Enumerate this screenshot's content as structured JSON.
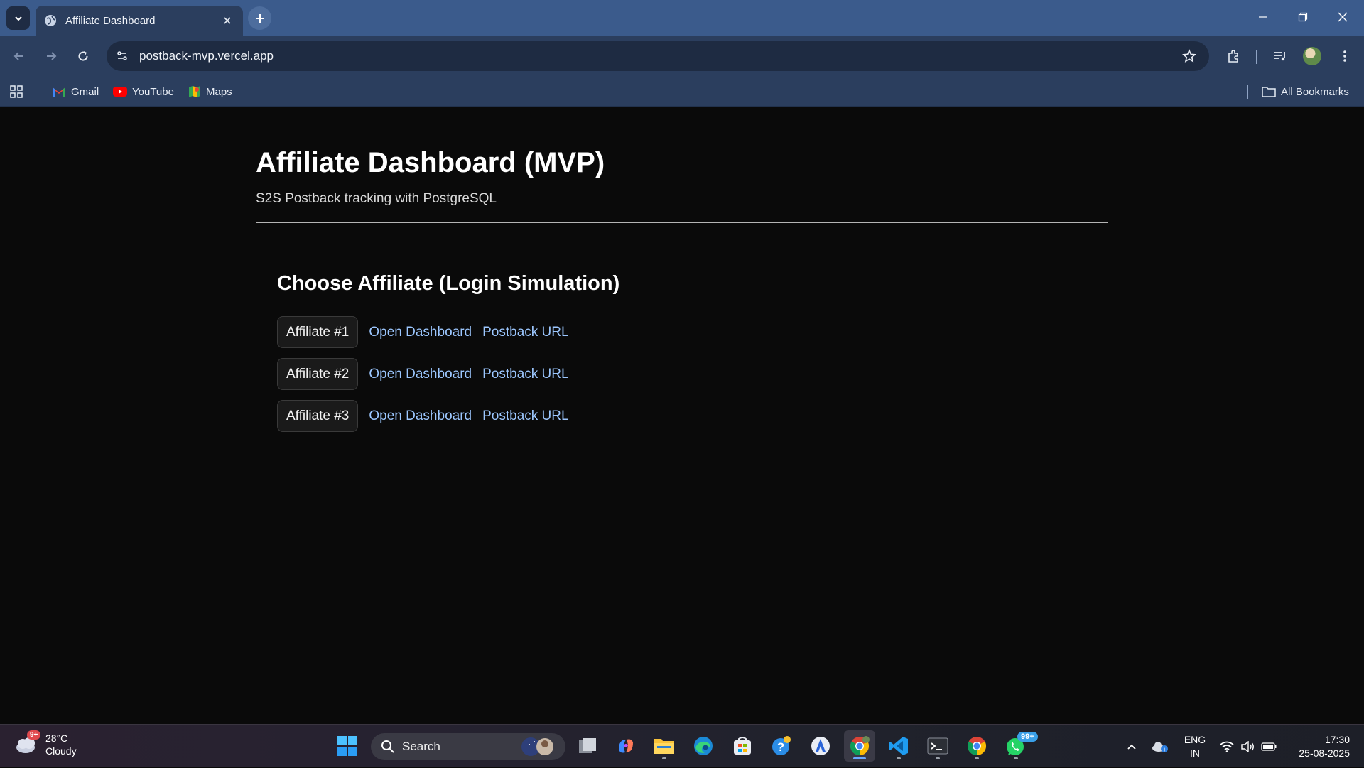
{
  "browser": {
    "tab_title": "Affiliate Dashboard",
    "url": "postback-mvp.vercel.app",
    "bookmarks": [
      {
        "label": "Gmail",
        "icon": "gmail-icon"
      },
      {
        "label": "YouTube",
        "icon": "youtube-icon"
      },
      {
        "label": "Maps",
        "icon": "maps-icon"
      }
    ],
    "all_bookmarks_label": "All Bookmarks"
  },
  "page": {
    "title": "Affiliate Dashboard (MVP)",
    "subtitle": "S2S Postback tracking with PostgreSQL",
    "section_title": "Choose Affiliate (Login Simulation)",
    "affiliates": [
      {
        "label": "Affiliate #1",
        "dashboard_link": "Open Dashboard",
        "postback_link": "Postback URL"
      },
      {
        "label": "Affiliate #2",
        "dashboard_link": "Open Dashboard",
        "postback_link": "Postback URL"
      },
      {
        "label": "Affiliate #3",
        "dashboard_link": "Open Dashboard",
        "postback_link": "Postback URL"
      }
    ]
  },
  "taskbar": {
    "weather": {
      "temp": "28°C",
      "condition": "Cloudy",
      "badge": "9+"
    },
    "search_label": "Search",
    "whatsapp_badge": "99+",
    "lang_line1": "ENG",
    "lang_line2": "IN",
    "time": "17:30",
    "date": "25-08-2025"
  },
  "colors": {
    "page_bg": "#0a0a0a",
    "link": "#9cc7ff",
    "chrome": "#2b3e5e",
    "tabbar": "#3b5b8c"
  }
}
